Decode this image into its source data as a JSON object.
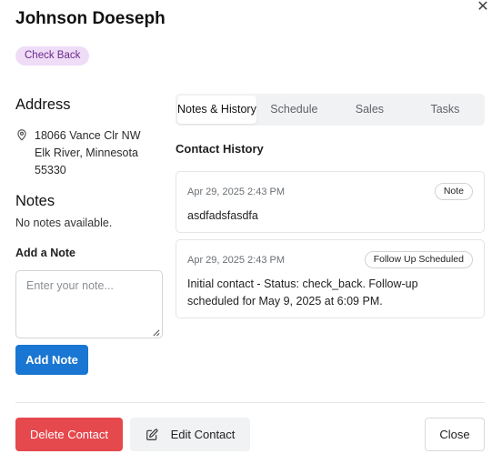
{
  "dialog": {
    "close_glyph": "✕",
    "contact_name": "Johnson Doeseph",
    "status_badge": "Check Back"
  },
  "address": {
    "title": "Address",
    "line1": "18066 Vance Clr NW",
    "line2": "Elk River, Minnesota",
    "line3": "55330"
  },
  "notes": {
    "title": "Notes",
    "empty_text": "No notes available.",
    "add_label": "Add a Note",
    "placeholder": "Enter your note...",
    "value": "",
    "add_button": "Add Note"
  },
  "tabs": [
    {
      "label": "Notes & History",
      "active": true
    },
    {
      "label": "Schedule",
      "active": false
    },
    {
      "label": "Sales",
      "active": false
    },
    {
      "label": "Tasks",
      "active": false
    }
  ],
  "history": {
    "title": "Contact History",
    "entries": [
      {
        "date": "Apr 29, 2025 2:43 PM",
        "badge": "Note",
        "text": "asdfadsfasdfa"
      },
      {
        "date": "Apr 29, 2025 2:43 PM",
        "badge": "Follow Up Scheduled",
        "text": "Initial contact - Status: check_back. Follow-up scheduled for May 9, 2025 at 6:09 PM."
      }
    ]
  },
  "footer": {
    "delete_label": "Delete Contact",
    "edit_label": "Edit Contact",
    "close_label": "Close"
  },
  "colors": {
    "primary": "#1976d2",
    "danger": "#e5484d",
    "badge_bg": "#efdcf7",
    "badge_text": "#6a2a8a"
  },
  "icons": [
    "close-icon",
    "map-pin-icon",
    "edit-icon",
    "resize-grip-icon"
  ]
}
